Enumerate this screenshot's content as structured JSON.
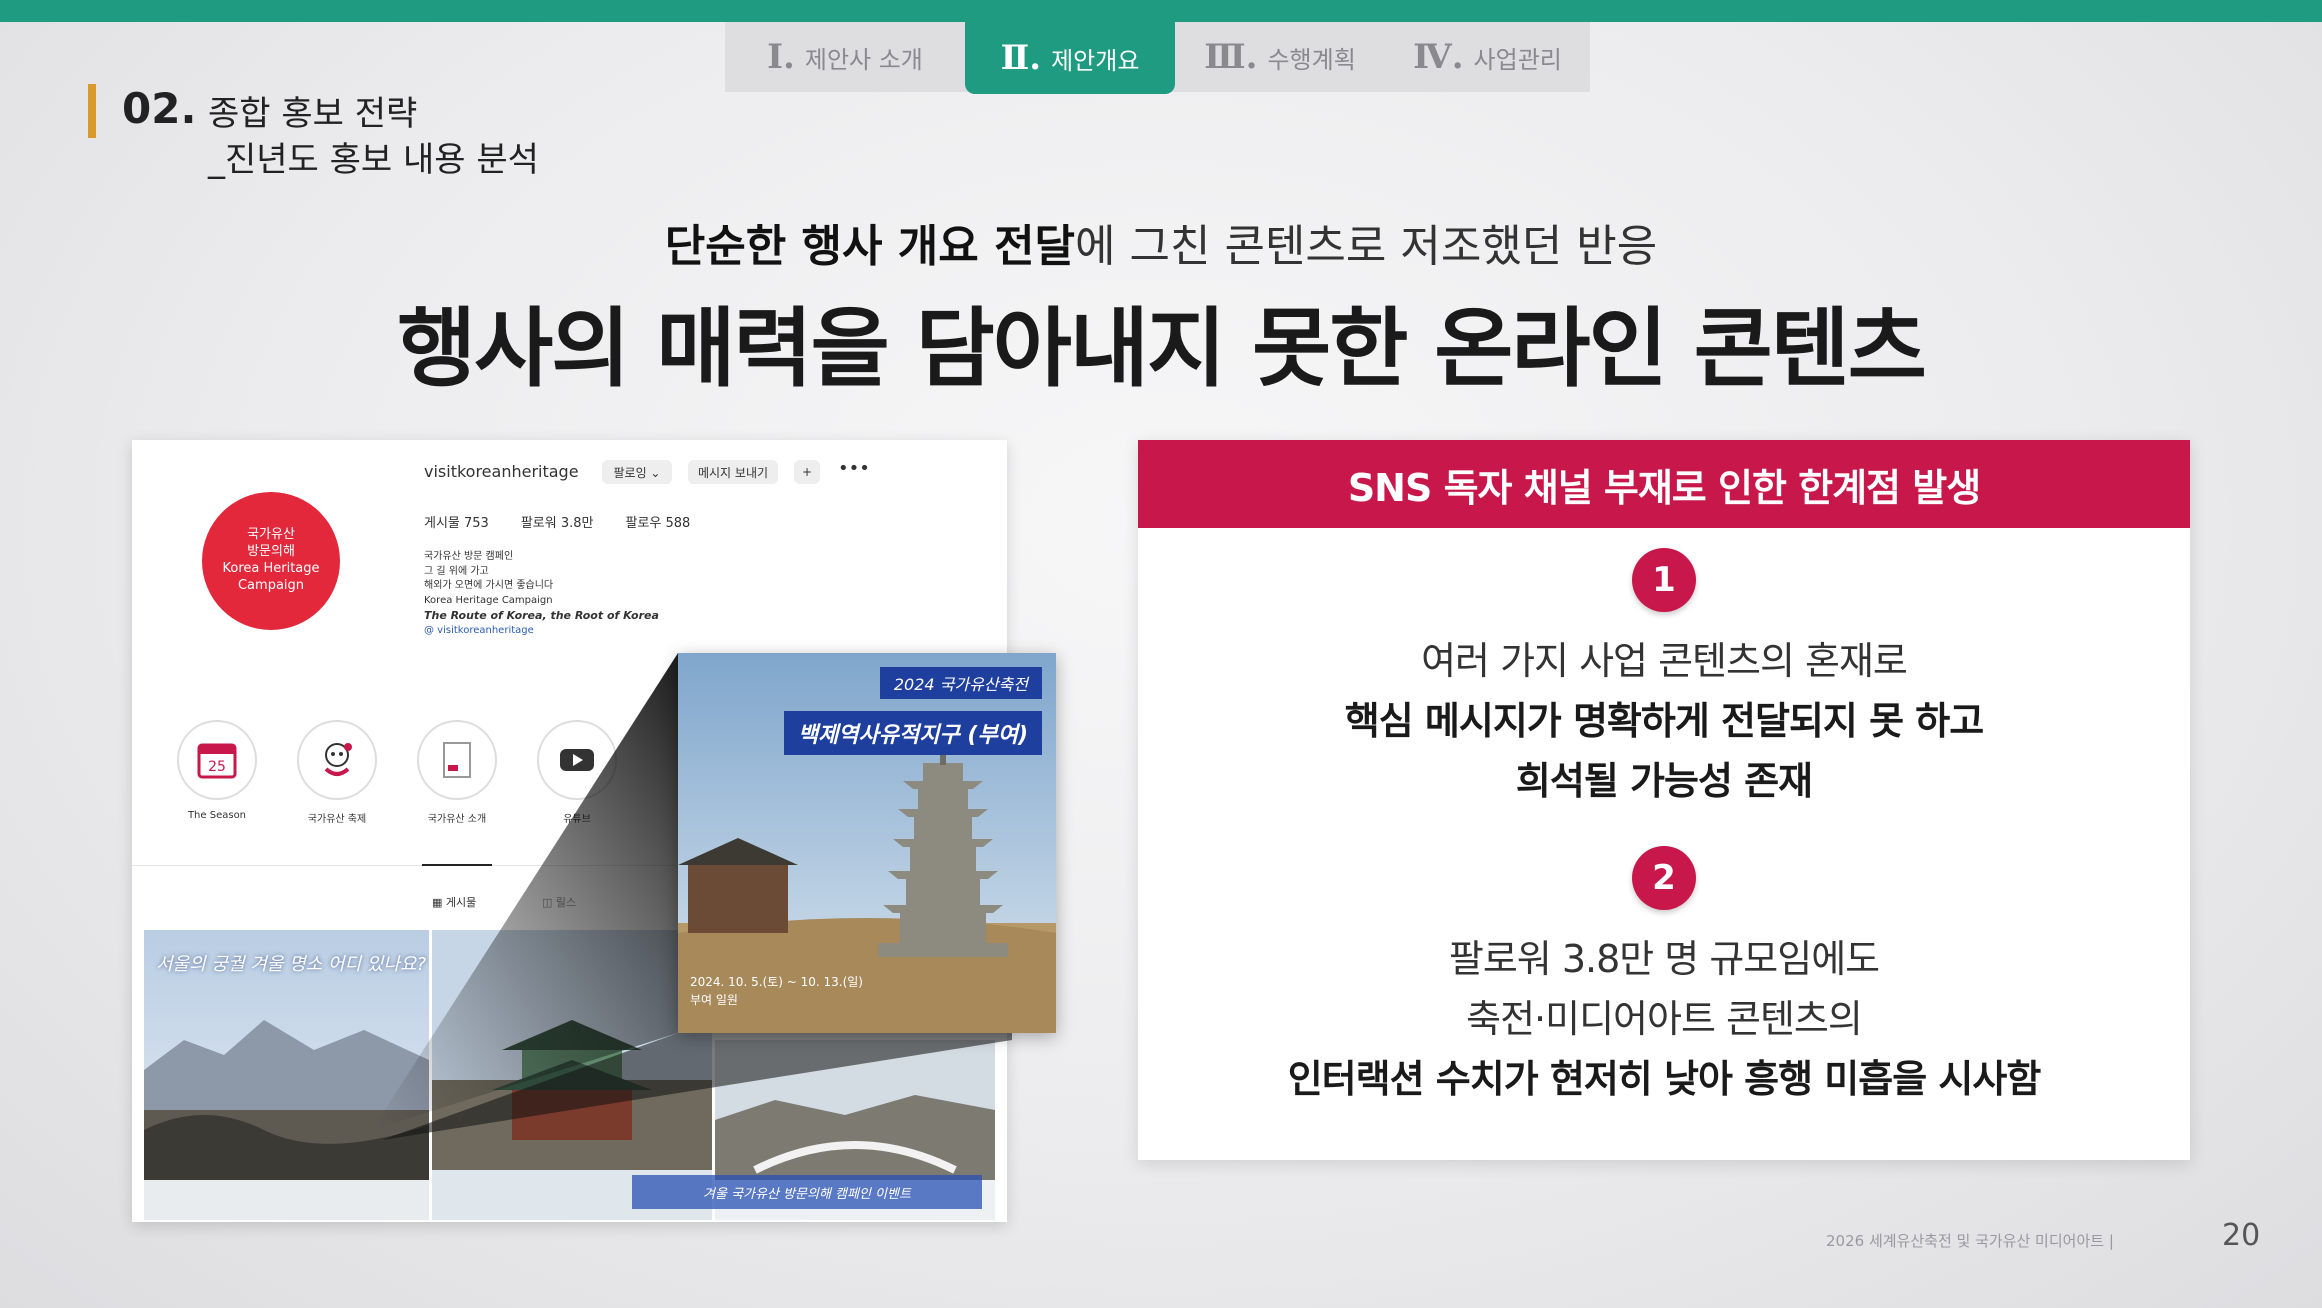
{
  "tabs": [
    {
      "num": "Ⅰ.",
      "label": "제안사 소개"
    },
    {
      "num": "Ⅱ.",
      "label": "제안개요"
    },
    {
      "num": "Ⅲ.",
      "label": "수행계획"
    },
    {
      "num": "Ⅳ.",
      "label": "사업관리"
    }
  ],
  "section": {
    "number": "02.",
    "title": "종합 홍보 전략",
    "subtitle": "_진년도 홍보 내용 분석"
  },
  "headline": {
    "sub_bold": "단순한 행사 개요 전달",
    "sub_rest": "에 그친 콘텐츠로 저조했던 반응",
    "main": "행사의 매력을 담아내지 못한 온라인 콘텐츠"
  },
  "instagram": {
    "username": "visitkoreanheritage",
    "follow_btn": "팔로잉 ⌄",
    "message_btn": "메시지 보내기",
    "plus_btn": "+",
    "more": "•••",
    "stats": [
      "게시물 753",
      "팔로워 3.8만",
      "팔로우 588"
    ],
    "avatar_text": "국가유산\n방문의해\nKorea Heritage\nCampaign",
    "bio_lines": [
      "국가유산 방문 캠페인",
      "그 길 위에 가고",
      "해외가 오면에 가시면 좋습니다",
      "Korea Heritage Campaign"
    ],
    "bio_em": "The Route of Korea, the Root of Korea",
    "bio_link": "@ visitkoreanheritage",
    "highlights": [
      "The Season",
      "국가유산 축제",
      "국가유산 소개",
      "유튜브"
    ],
    "tab_posts": "▦ 게시물",
    "tab_tagged": "◫ 릴스",
    "photo_caption": "서울의 궁궐 겨울 명소 어디 있나요?",
    "photo_banner": "겨울 국가유산 방문의해 캠페인 이벤트"
  },
  "zoom_card": {
    "title1": "2024 국가유산축전",
    "title2": "백제역사유적지구 (부여)",
    "date": "2024. 10. 5.(토) ~ 10. 13.(일)\n부여 일원"
  },
  "panel": {
    "header": "SNS 독자 채널 부재로 인한 한계점 발생",
    "point1": {
      "num": "1",
      "line1": "여러 가지 사업 콘텐츠의 혼재로",
      "line2": "핵심 메시지가 명확하게 전달되지 못 하고",
      "line3": "희석될 가능성 존재"
    },
    "point2": {
      "num": "2",
      "line1": "팔로워 3.8만 명 규모임에도",
      "line2": "축전·미디어아트 콘텐츠의",
      "line3": "인터랙션 수치가 현저히 낮아 흥행 미흡을 시사함"
    }
  },
  "footer": {
    "text": "2026 세계유산축전 및 국가유산 미디어아트 |",
    "page": "20"
  },
  "colors": {
    "accent_green": "#1e9b80",
    "accent_red": "#c8174a",
    "section_bar": "#d99a2b"
  }
}
